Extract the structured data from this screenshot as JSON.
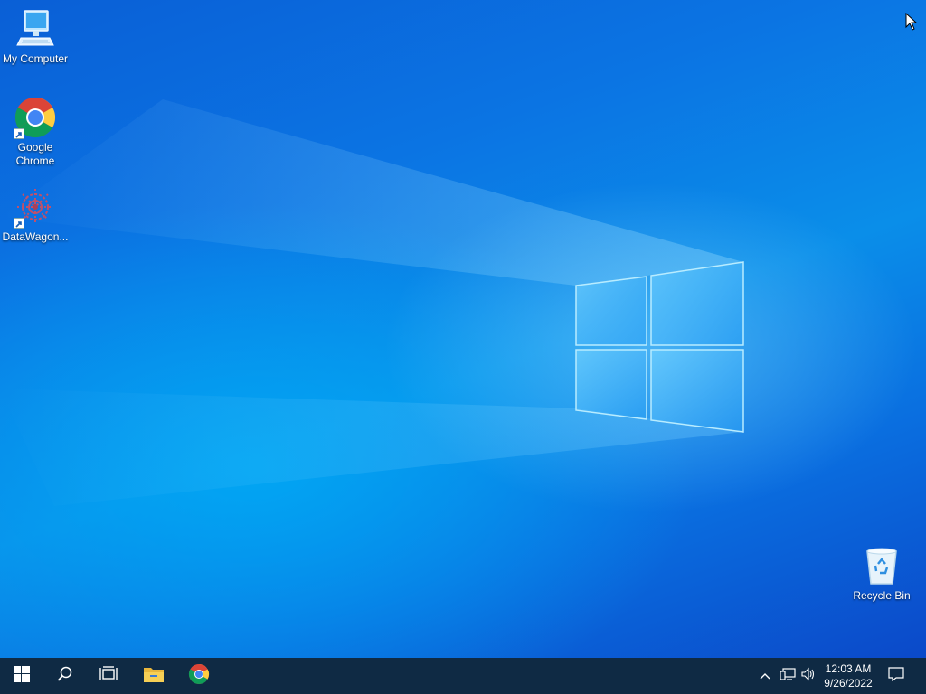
{
  "desktop": {
    "icons": [
      {
        "label": "My Computer",
        "icon": "computer-icon",
        "shortcut": false
      },
      {
        "label": "Google Chrome",
        "icon": "chrome-icon",
        "shortcut": true
      },
      {
        "label": "DataWagon...",
        "icon": "datawagon-icon",
        "shortcut": true
      },
      {
        "label": "Recycle Bin",
        "icon": "recycle-bin-icon",
        "shortcut": false
      }
    ]
  },
  "taskbar": {
    "buttons": [
      {
        "name": "start",
        "icon": "windows-logo-icon"
      },
      {
        "name": "search",
        "icon": "search-icon"
      },
      {
        "name": "task-view",
        "icon": "task-view-icon"
      },
      {
        "name": "file-explorer",
        "icon": "folder-icon"
      },
      {
        "name": "chrome",
        "icon": "chrome-icon"
      }
    ],
    "tray": {
      "icons": [
        "chevron-up-icon",
        "network-icon",
        "speaker-icon"
      ],
      "time": "12:03 AM",
      "date": "9/26/2022",
      "notification_icon": "notification-icon"
    }
  },
  "colors": {
    "taskbar": "#0f2a44",
    "desktop_accent": "#0a8ee9"
  }
}
